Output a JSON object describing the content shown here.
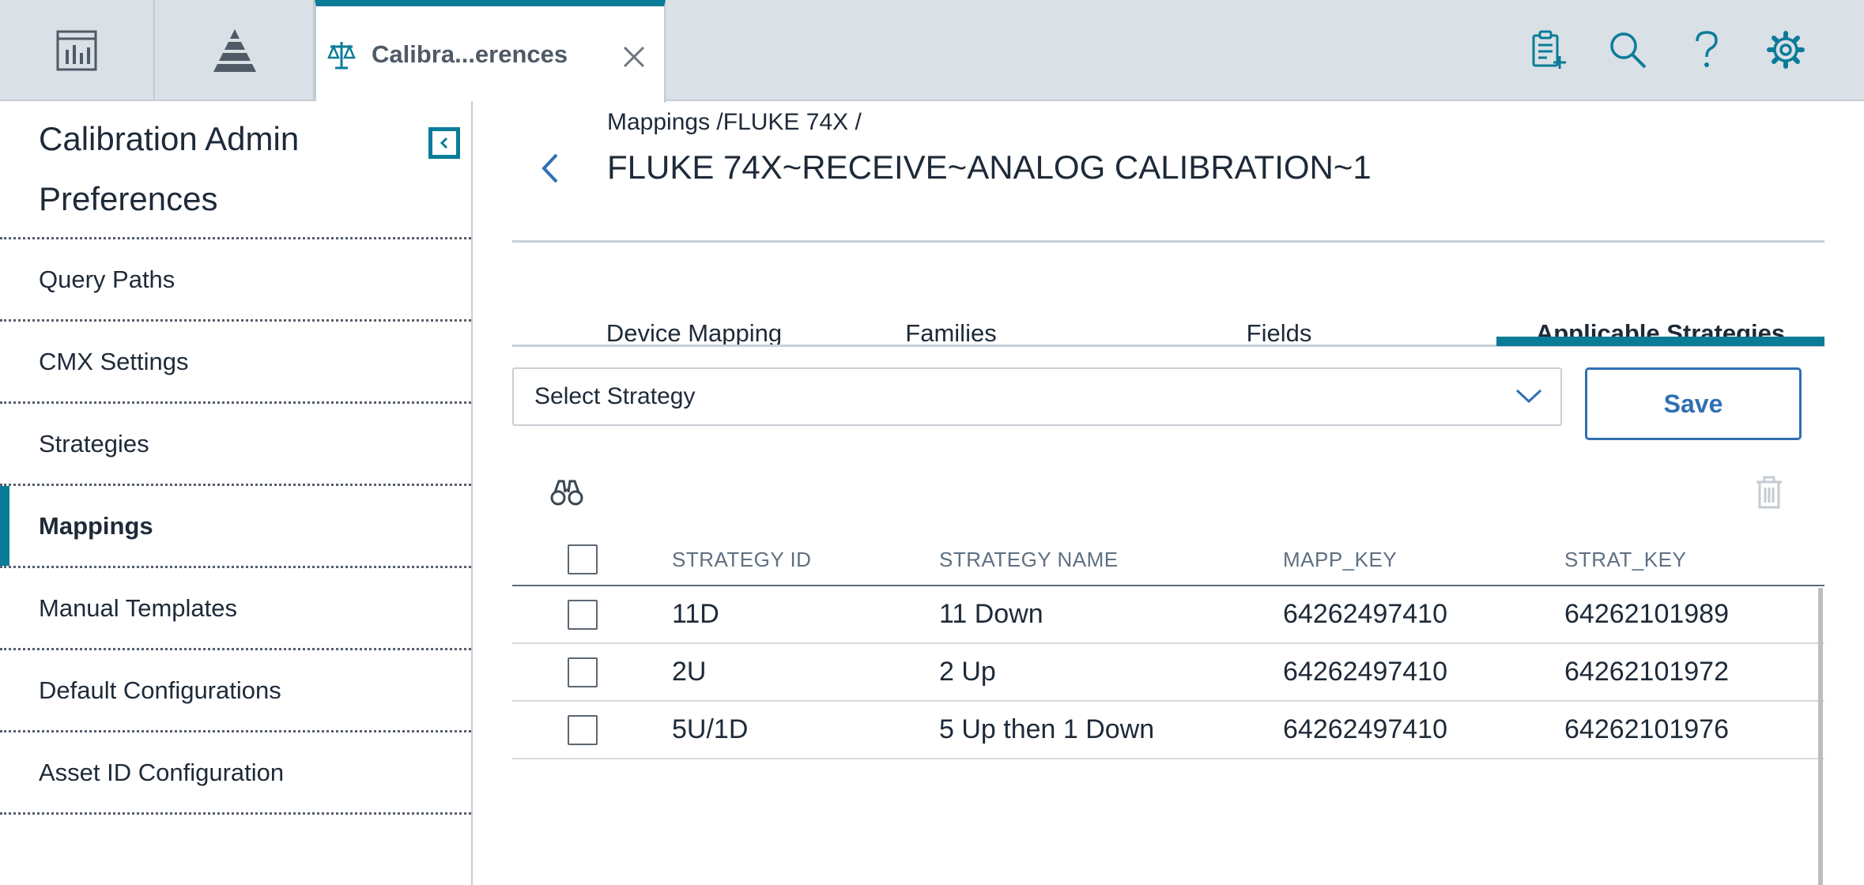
{
  "top_tabs": {
    "active_tab_title": "Calibra...erences",
    "icons": [
      "dashboard-icon",
      "pyramid-icon",
      "scale-icon",
      "close-icon"
    ]
  },
  "toolbar_icons": [
    "clipboard-add-icon",
    "search-icon",
    "help-icon",
    "gear-icon"
  ],
  "sidebar": {
    "title": "Calibration Admin Preferences",
    "items": [
      {
        "label": "Query Paths"
      },
      {
        "label": "CMX Settings"
      },
      {
        "label": "Strategies"
      },
      {
        "label": "Mappings",
        "active": true
      },
      {
        "label": "Manual Templates"
      },
      {
        "label": "Default Configurations"
      },
      {
        "label": "Asset ID Configuration"
      }
    ]
  },
  "main": {
    "breadcrumb": "Mappings /FLUKE 74X /",
    "title": "FLUKE 74X~RECEIVE~ANALOG CALIBRATION~1",
    "tabs": [
      {
        "label": "Device Mapping"
      },
      {
        "label": "Families"
      },
      {
        "label": "Fields"
      },
      {
        "label": "Applicable Strategies",
        "active": true
      }
    ],
    "strategy_select": {
      "placeholder": "Select Strategy"
    },
    "save_label": "Save",
    "grid": {
      "columns": [
        "STRATEGY ID",
        "STRATEGY NAME",
        "MAPP_KEY",
        "STRAT_KEY"
      ],
      "rows": [
        {
          "strategy_id": "11D",
          "strategy_name": "11 Down",
          "mapp_key": "64262497410",
          "strat_key": "64262101989"
        },
        {
          "strategy_id": "2U",
          "strategy_name": "2 Up",
          "mapp_key": "64262497410",
          "strat_key": "64262101972"
        },
        {
          "strategy_id": "5U/1D",
          "strategy_name": "5 Up then 1 Down",
          "mapp_key": "64262497410",
          "strat_key": "64262101976"
        }
      ]
    }
  },
  "colors": {
    "accent": "#0b7c98",
    "link_blue": "#2f6fb4",
    "topbar_bg": "#d9e0e6"
  }
}
